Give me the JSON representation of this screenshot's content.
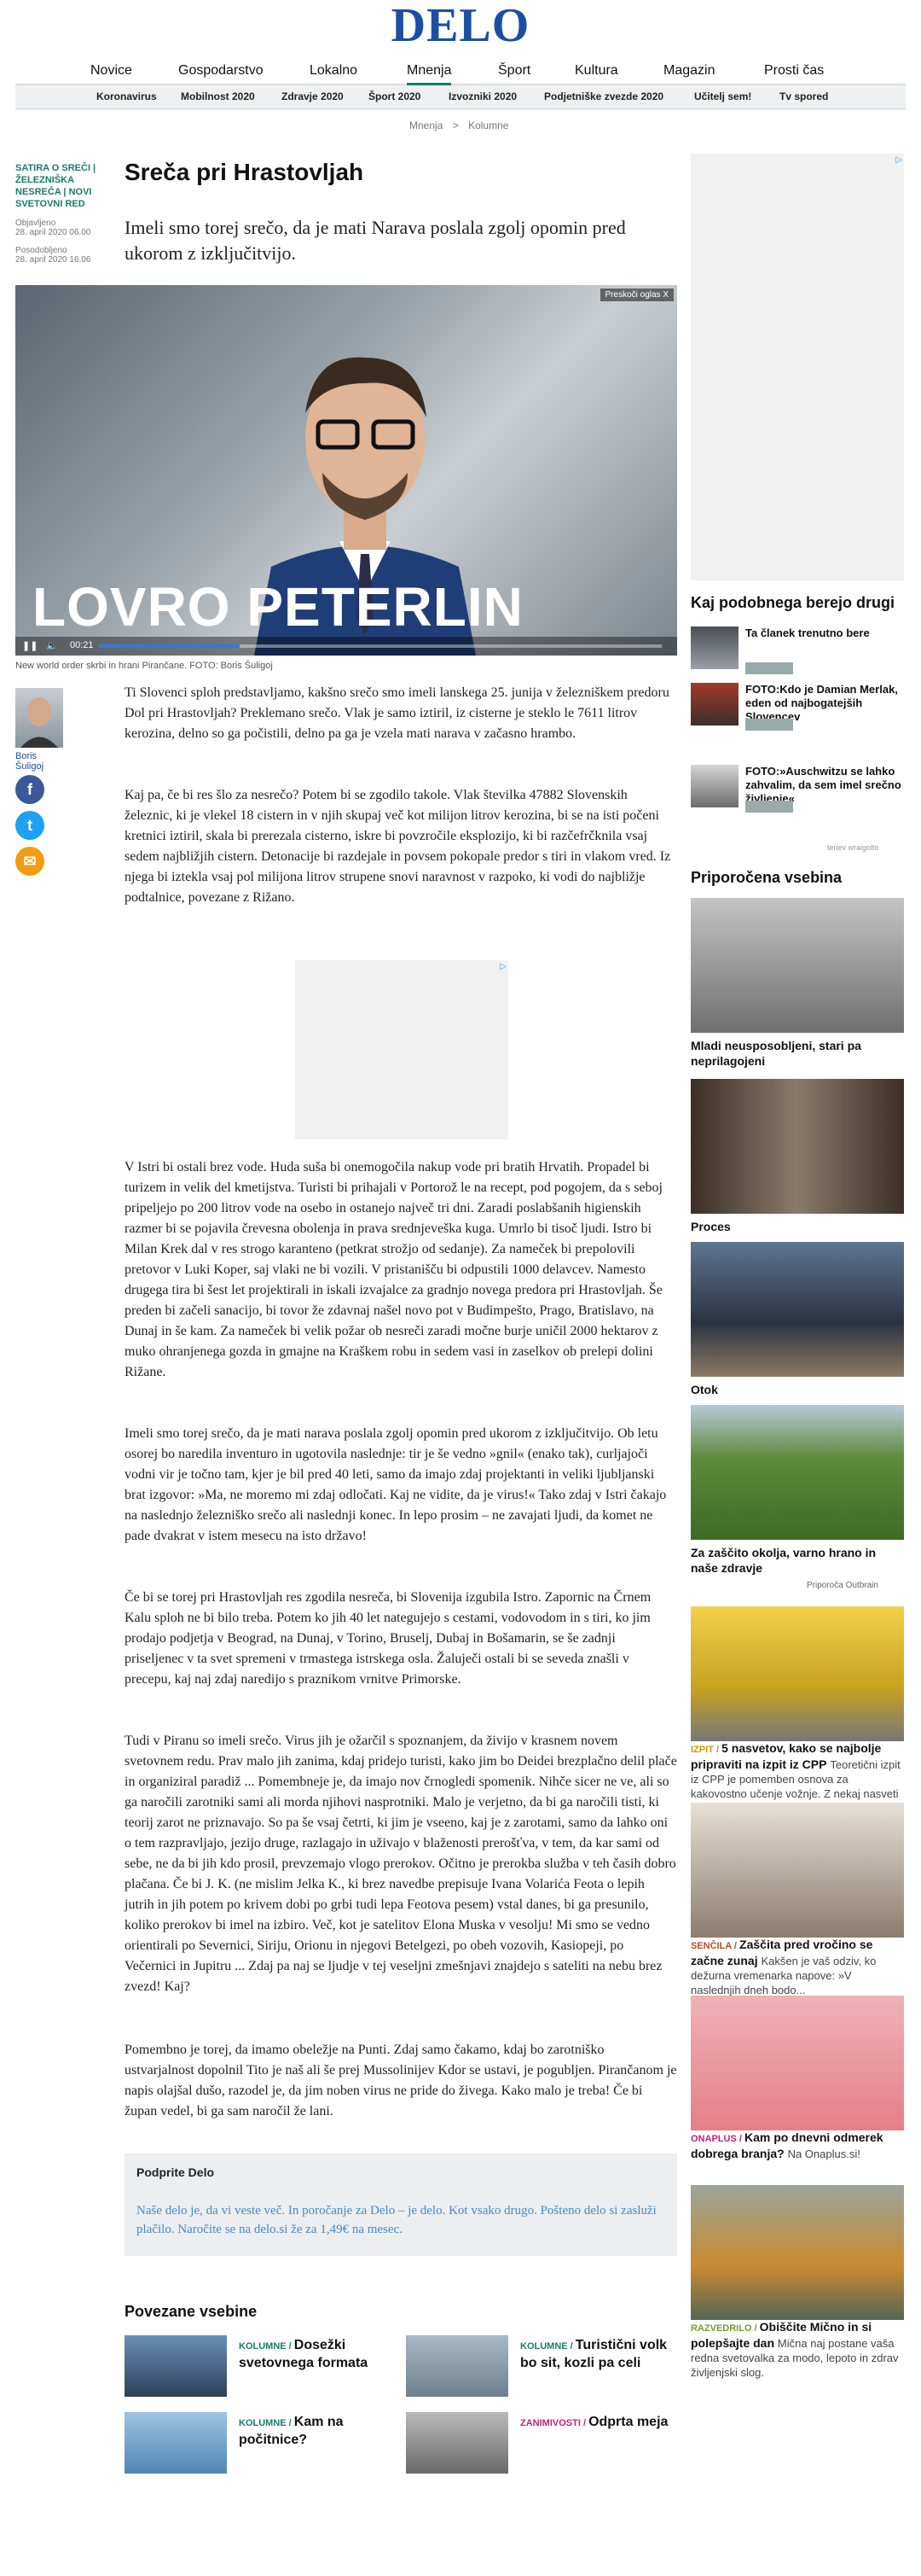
{
  "logo": "DELO",
  "nav": [
    "Novice",
    "Gospodarstvo",
    "Lokalno",
    "Mnenja",
    "Šport",
    "Kultura",
    "Magazin",
    "Prosti čas"
  ],
  "subnav": [
    "Koronavirus",
    "Mobilnost 2020",
    "Zdravje 2020",
    "Šport 2020",
    "Izvozniki 2020",
    "Podjetniške zvezde 2020",
    "Učitelj sem!",
    "Tv spored"
  ],
  "breadcrumb": {
    "a": "Mnenja",
    "sep": ">",
    "b": "Kolumne"
  },
  "meta": {
    "series": "SATIRA O SREČI | ŽELEZNIŠKA NESREČA | NOVI SVETOVNI RED",
    "published_label": "Objavljeno",
    "published": "28. april 2020 06.00",
    "updated_label": "Posodobljeno",
    "updated": "28. april 2020 16.06"
  },
  "title": "Sreča pri Hrastovljah",
  "lead": "Imeli smo torej srečo, da je mati Narava poslala zgolj opomin pred ukorom z izključitvijo.",
  "hero": {
    "skip": "Preskoči oglas X",
    "name": "LOVRO PETERLIN",
    "time": "00:21"
  },
  "caption": "New world order skrbi in hrani Pirančane. FOTO: Boris Šuligoj",
  "author": "Boris Šuligoj",
  "paragraphs": [
    "Ti Slovenci sploh predstavljamo, kakšno srečo smo imeli lanskega 25. junija v železniškem predoru Dol pri Hrastovljah? Preklemano srečo. Vlak je samo iztiril, iz cisterne je steklo le 7611 litrov kerozina, delno so ga počistili, delno pa ga je vzela mati narava v začasno hrambo.",
    "Kaj pa, če bi res šlo za nesrečo? Potem bi se zgodilo takole. Vlak številka 47882 Slovenskih železnic, ki je vlekel 18 cistern in v njih skupaj več kot milijon litrov kerozina, bi se na isti počeni kretnici iztiril, skala bi prerezala cisterno, iskre bi povzročile eksplozijo, ki bi razčefrčknila vsaj sedem najbližjih cistern. Detonacije bi razdejale in povsem pokopale predor s tiri in vlakom vred. Iz njega bi iztekla vsaj pol milijona litrov strupene snovi naravnost v razpoko, ki vodi do najbližje podtalnice, povezane z Rižano.",
    "V Istri bi ostali brez vode. Huda suša bi onemogočila nakup vode pri bratih Hrvatih. Propadel bi turizem in velik del kmetijstva. Turisti bi prihajali v Portorož le na recept, pod pogojem, da s seboj pripeljejo po 200 litrov vode na osebo in ostanejo največ tri dni. Zaradi poslabšanih higienskih razmer bi se pojavila črevesna obolenja in prava srednjeveška kuga. Umrlo bi tisoč ljudi. Istro bi Milan Krek dal v res strogo karanteno (petkrat strožjo od sedanje). Za nameček bi prepolovili pretovor v Luki Koper, saj vlaki ne bi vozili. V pristanišču bi odpustili 1000 delavcev. Namesto drugega tira bi šest let projektirali in iskali izvajalce za gradnjo novega predora pri Hrastovljah. Še preden bi začeli sanacijo, bi tovor že zdavnaj našel novo pot v Budimpešto, Prago, Bratislavo, na Dunaj in še kam. Za nameček bi velik požar ob nesreči zaradi močne burje uničil 2000 hektarov z muko ohranjenega gozda in gmajne na Kraškem robu in sedem vasi in zaselkov ob prelepi dolini Rižane.",
    "Imeli smo torej srečo, da je mati narava poslala zgolj opomin pred ukorom z izključitvijo. Ob letu osorej bo naredila inventuro in ugotovila naslednje: tir je še vedno »gnil« (enako tak), curljajoči vodni vir je točno tam, kjer je bil pred 40 leti, samo da imajo zdaj projektanti in veliki ljubljanski brat izgovor: »Ma, ne moremo mi zdaj odločati. Kaj ne vidite, da je virus!« Tako zdaj v Istri čakajo na naslednjo železniško srečo ali naslednji konec. In lepo prosim – ne zavajati ljudi, da komet ne pade dvakrat v istem mesecu na isto državo!",
    "Če bi se torej pri Hrastovljah res zgodila nesreča, bi Slovenija izgubila Istro. Zapornic na Črnem Kalu sploh ne bi bilo treba. Potem ko jih 40 let nategujejo s cestami, vodovodom in s tiri, ko jim prodajo podjetja v Beograd, na Dunaj, v Torino, Bruselj, Dubaj in Bošamarin, se še zadnji priseljenec v ta svet spremeni v trmastega istrskega osla. Žaluječi ostali bi se seveda znašli v precepu, kaj naj zdaj naredijo s praznikom vrnitve Primorske.",
    "Tudi v Piranu so imeli srečo. Virus jih je ožarčil s spoznanjem, da živijo v krasnem novem svetovnem redu. Prav malo jih zanima, kdaj pridejo turisti, kako jim bo Deidei brezplačno delil plače in organiziral paradiž ... Pomembneje je, da imajo nov črnogledi spomenik. Nihče sicer ne ve, ali so ga naročili zarotniki sami ali morda njihovi nasprotniki. Malo je verjetno, da bi ga naročili tisti, ki teorij zarot ne priznavajo. So pa še vsaj četrti, ki jim je vseeno, kaj je z zarotami, samo da lahko oni o tem razpravljajo, jezijo druge, razlagajo in uživajo v blaženosti prerošťva, v tem, da kar sami od sebe, ne da bi jih kdo prosil, prevzemajo vlogo prerokov. Očitno je prerokba služba v teh časih dobro plačana. Če bi J. K. (ne mislim Jelka K., ki brez navedbe prepisuje Ivana Volarića Feota o lepih jutrih in jih potem po krivem dobi po grbi tudi lepa Feotova pesem) vstal danes, bi ga presunilo, koliko prerokov bi imel na izbiro. Več, kot je satelitov Elona Muska v vesolju! Mi smo se vedno orientirali po Severnici, Siriju, Orionu in njegovi Betelgezi, po obeh vozovih, Kasiopeji, po Večernici in Jupitru ... Zdaj pa naj se ljudje v tej veseljni zmešnjavi znajdejo s sateliti na nebu brez zvezd! Kaj?",
    "Pomembno je torej, da imamo obeležje na Punti. Zdaj samo čakamo, kdaj bo zarotniško ustvarjalnost dopolnil Tito je naš ali še prej Mussolinijev Kdor se ustavi, je pogubljen. Pirančanom je napis olajšal dušo, razodel je, da jim noben virus ne pride do živega. Kako malo je treba! Če bi župan vedel, bi ga sam naročil že lani."
  ],
  "subscribe": {
    "title": "Podprite Delo",
    "text": "Naše delo je, da vi veste več. In poročanje za Delo – je delo. Kot vsako drugo. Pošteno delo si zasluži plačilo. Naročite se na delo.si že za 1,49€ na mesec."
  },
  "related_heading": "Povezane vsebine",
  "related": [
    {
      "cat": "KOLUMNE",
      "sep": " / ",
      "title": "Dosežki svetovnega formata"
    },
    {
      "cat": "KOLUMNE",
      "sep": " / ",
      "title": "Turistični volk bo sit, kozli pa celi"
    },
    {
      "cat": "KOLUMNE",
      "sep": " / ",
      "title": "Kam na počitnice?"
    },
    {
      "cat": "ZANIMIVOSTI",
      "sep": " / ",
      "title": "Odprta meja"
    }
  ],
  "sidebar": {
    "others_heading": "Kaj podobnega berejo drugi",
    "others": [
      {
        "title": "Ta članek trenutno bere"
      },
      {
        "title": "FOTO:Kdo je Damian Merlak, eden od najbogatejših Slovencev"
      },
      {
        "title": "FOTO:»Auschwitzu se lahko zahvalim, da sem imel srečno življenje«"
      }
    ],
    "others_credit": "teriev wraigolto",
    "rec_heading": "Priporočena vsebina",
    "rec": [
      "Mladi neusposobljeni, stari pa neprilagojeni",
      "Proces",
      "Otok",
      "Za zaščito okolja, varno hrano in naše zdravje"
    ],
    "outbrain": "Priporoča Outbrain",
    "sponsored": [
      {
        "src": "IZPIT",
        "sep": " / ",
        "head": "5 nasvetov, kako se najbolje pripraviti na izpit iz CPP",
        "text": "Teoretični izpit iz CPP je pomemben osnova za kakovostno učenje vožnje. Z nekaj nasveti ga lahko opravite z odliko."
      },
      {
        "src": "SENČILA",
        "sep": " / ",
        "head": "Zaščita pred vročino se začne zunaj",
        "text": "Kakšen je vaš odziv, ko dežurna vremenarka napove: »V naslednjih dneh bodo..."
      },
      {
        "src": "ONAPLUS",
        "sep": " / ",
        "head": "Kam po dnevni odmerek dobrega branja?",
        "text": "Na Onaplus.si!"
      },
      {
        "src": "RAZVEDRILO",
        "sep": " / ",
        "head": "Obiščite Mično in si polepšajte dan",
        "text": "Mična naj postane vaša redna svetovalka za modo, lepoto in zdrav življenjski slog."
      }
    ]
  },
  "colors": {
    "brand": "#1a4fa3",
    "accent": "#1a7a6a",
    "facebook": "#3b5998",
    "twitter": "#1da1f2",
    "mail": "#f39c12"
  }
}
